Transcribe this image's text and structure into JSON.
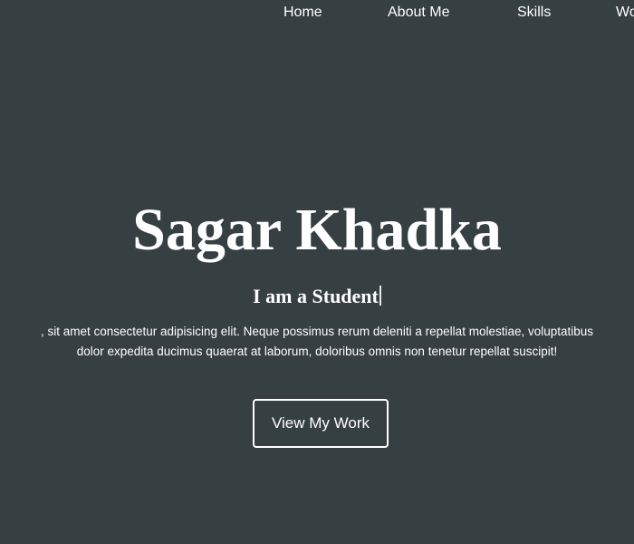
{
  "nav": {
    "items": [
      {
        "label": "Home"
      },
      {
        "label": "About Me"
      },
      {
        "label": "Skills"
      },
      {
        "label": "Work"
      }
    ]
  },
  "hero": {
    "name": "Sagar Khadka",
    "subtitle": "I am a Student",
    "text_line1": ", sit amet consectetur adipisicing elit. Neque possimus rerum deleniti a repellat molestiae, voluptatibus",
    "text_line2": "dolor expedita ducimus quaerat at laborum, doloribus omnis non tenetur repellat suscipit!",
    "cta_label": "View My Work"
  },
  "colors": {
    "background": "#363f42",
    "text": "#ffffff"
  }
}
